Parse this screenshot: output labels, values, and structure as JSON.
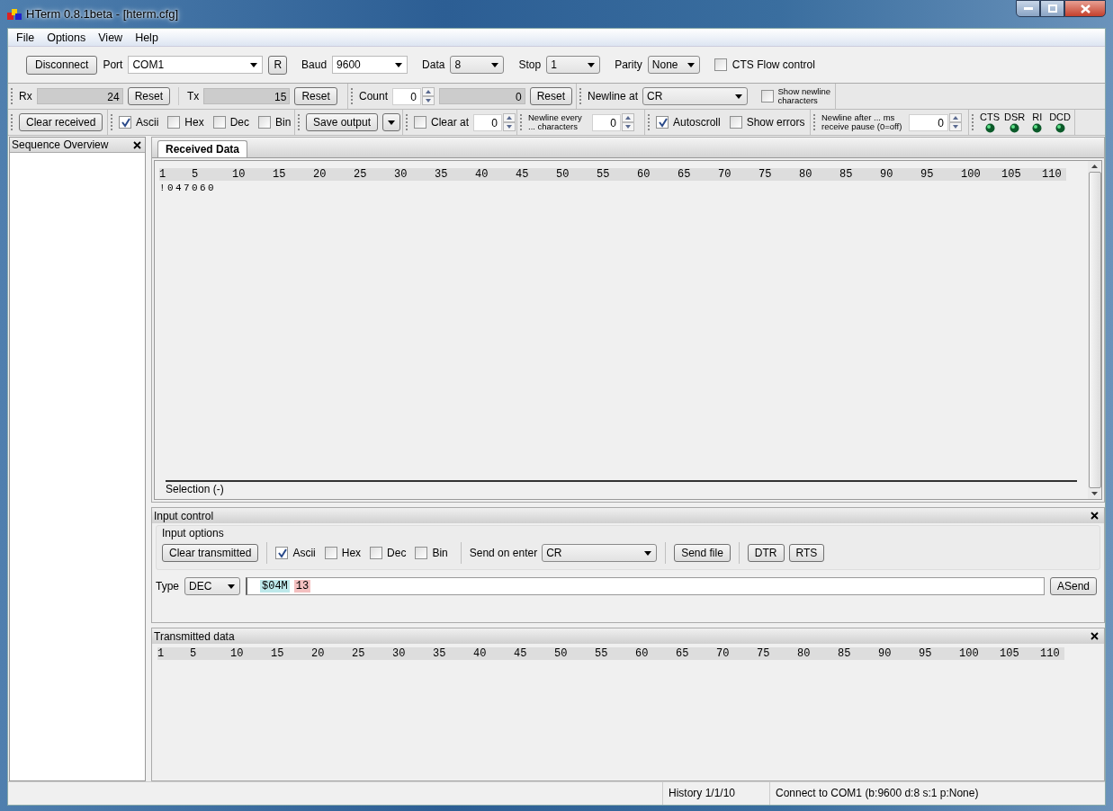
{
  "window": {
    "title": "HTerm 0.8.1beta - [hterm.cfg]"
  },
  "menu": [
    "File",
    "Options",
    "View",
    "Help"
  ],
  "connection": {
    "disconnect": "Disconnect",
    "port_label": "Port",
    "port": "COM1",
    "refresh": "R",
    "baud_label": "Baud",
    "baud": "9600",
    "data_label": "Data",
    "data": "8",
    "stop_label": "Stop",
    "stop": "1",
    "parity_label": "Parity",
    "parity": "None",
    "cts_flow": {
      "label": "CTS Flow control",
      "checked": false
    }
  },
  "counters": {
    "rx_label": "Rx",
    "rx": "24",
    "rx_reset": "Reset",
    "tx_label": "Tx",
    "tx": "15",
    "tx_reset": "Reset",
    "count_label": "Count",
    "count": "0",
    "count_value": "0",
    "count_reset": "Reset",
    "newline_label": "Newline at",
    "newline": "CR",
    "show_newline": {
      "label": "Show newline characters",
      "checked": false
    }
  },
  "receive_options": {
    "clear": "Clear received",
    "formats": [
      {
        "label": "Ascii",
        "checked": true
      },
      {
        "label": "Hex",
        "checked": false
      },
      {
        "label": "Dec",
        "checked": false
      },
      {
        "label": "Bin",
        "checked": false
      }
    ],
    "save_output": "Save output",
    "clear_at": {
      "label": "Clear at",
      "checked": false,
      "value": "0"
    },
    "newline_every": {
      "label": "Newline every ... characters",
      "value": "0"
    },
    "autoscroll": {
      "label": "Autoscroll",
      "checked": true
    },
    "show_errors": {
      "label": "Show errors",
      "checked": false
    },
    "newline_after": {
      "label": "Newline after ... ms receive pause (0=off)",
      "value": "0"
    },
    "signals": [
      "CTS",
      "DSR",
      "RI",
      "DCD"
    ]
  },
  "sidebar": {
    "title": "Sequence Overview"
  },
  "received": {
    "tab": "Received Data",
    "ruler": [
      "1",
      "5",
      "10",
      "15",
      "20",
      "25",
      "30",
      "35",
      "40",
      "45",
      "50",
      "55",
      "60",
      "65",
      "70",
      "75",
      "80",
      "85",
      "90",
      "95",
      "100",
      "105",
      "110"
    ],
    "lines": [
      "!047060"
    ],
    "selection": "Selection (-)"
  },
  "input_control": {
    "title": "Input control",
    "options_title": "Input options",
    "clear": "Clear transmitted",
    "formats": [
      {
        "label": "Ascii",
        "checked": true
      },
      {
        "label": "Hex",
        "checked": false
      },
      {
        "label": "Dec",
        "checked": false
      },
      {
        "label": "Bin",
        "checked": false
      }
    ],
    "send_on_enter_label": "Send on enter",
    "send_on_enter": "CR",
    "send_file": "Send file",
    "dtr": "DTR",
    "rts": "RTS",
    "type_label": "Type",
    "type": "DEC",
    "tokens": [
      {
        "text": "$04M",
        "kind": "ascii"
      },
      {
        "text": "13",
        "kind": "dec"
      }
    ],
    "asend": "ASend"
  },
  "transmitted": {
    "title": "Transmitted data",
    "ruler": [
      "1",
      "5",
      "10",
      "15",
      "20",
      "25",
      "30",
      "35",
      "40",
      "45",
      "50",
      "55",
      "60",
      "65",
      "70",
      "75",
      "80",
      "85",
      "90",
      "95",
      "100",
      "105",
      "110"
    ]
  },
  "status_bar": {
    "history": "History 1/1/10",
    "connection": "Connect to COM1 (b:9600 d:8 s:1 p:None)"
  }
}
